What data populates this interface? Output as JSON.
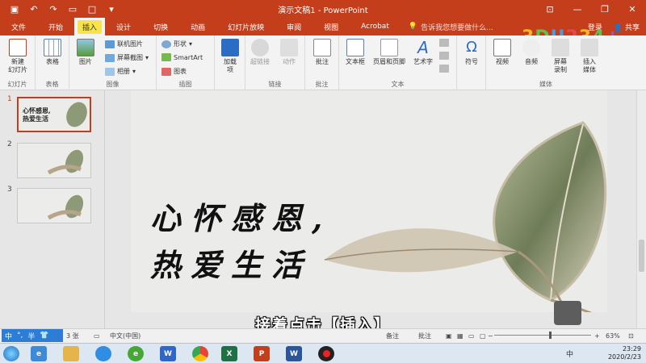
{
  "window": {
    "title": "演示文稿1 - PowerPoint",
    "minimize": "—",
    "restore": "❐",
    "close": "✕"
  },
  "qat": {
    "save": "💾",
    "undo": "↶",
    "redo": "↷",
    "present": "▭",
    "new": "□",
    "more": "▾"
  },
  "tabs": [
    {
      "label": "文件"
    },
    {
      "label": "开始"
    },
    {
      "label": "插入"
    },
    {
      "label": "设计"
    },
    {
      "label": "切换"
    },
    {
      "label": "动画"
    },
    {
      "label": "幻灯片放映"
    },
    {
      "label": "审阅"
    },
    {
      "label": "视图"
    },
    {
      "label": "Acrobat"
    }
  ],
  "tellme": {
    "icon": "lightbulb-icon",
    "text": "告诉我您想要做什么..."
  },
  "account": {
    "signin": "登录",
    "share": "共享"
  },
  "ribbon": {
    "new_slide": "新建\n幻灯片",
    "table": "表格",
    "picture": "图片",
    "online_picture": "联机图片",
    "screenshot": "屏幕截图",
    "album": "相册",
    "shapes": "形状",
    "smartart": "SmartArt",
    "chart": "图表",
    "addins": "加载\n项",
    "hyperlink": "超链接",
    "action": "动作",
    "comment": "批注",
    "textbox": "文本框",
    "header_footer": "页眉和页脚",
    "wordart": "艺术字",
    "symbol": "符号",
    "video": "视频",
    "audio": "音频",
    "screen_record": "屏幕\n录制",
    "insert_media": "插入\n媒体",
    "groups": {
      "slides": "幻灯片",
      "tables": "表格",
      "images": "图像",
      "illustrations": "插图",
      "links": "链接",
      "comments": "批注",
      "text": "文本",
      "media": "媒体"
    }
  },
  "slides": [
    {
      "num": "1",
      "text": "心怀感恩,\n热爱生活"
    },
    {
      "num": "2",
      "text": ""
    },
    {
      "num": "3",
      "text": ""
    }
  ],
  "main_slide": {
    "line1": "心怀感恩,",
    "line2": "热爱生活"
  },
  "caption": "接着点击【插入】",
  "status": {
    "slide_count": "3 张",
    "language": "中文(中国)",
    "notes": "备注",
    "comments": "批注",
    "zoom": "63%"
  },
  "ime": {
    "label": "中",
    "punct": "°,",
    "mode": "半"
  },
  "taskbar": {
    "date": "2020/2/23",
    "time": "23:29",
    "ime": "中"
  },
  "logo": [
    "3",
    "D",
    "U",
    "2",
    "3",
    "4",
    ""
  ],
  "colors": {
    "accent": "#c43e1c",
    "ribbon_bg": "#f3f3f3",
    "highlight": "#f8e44a"
  }
}
